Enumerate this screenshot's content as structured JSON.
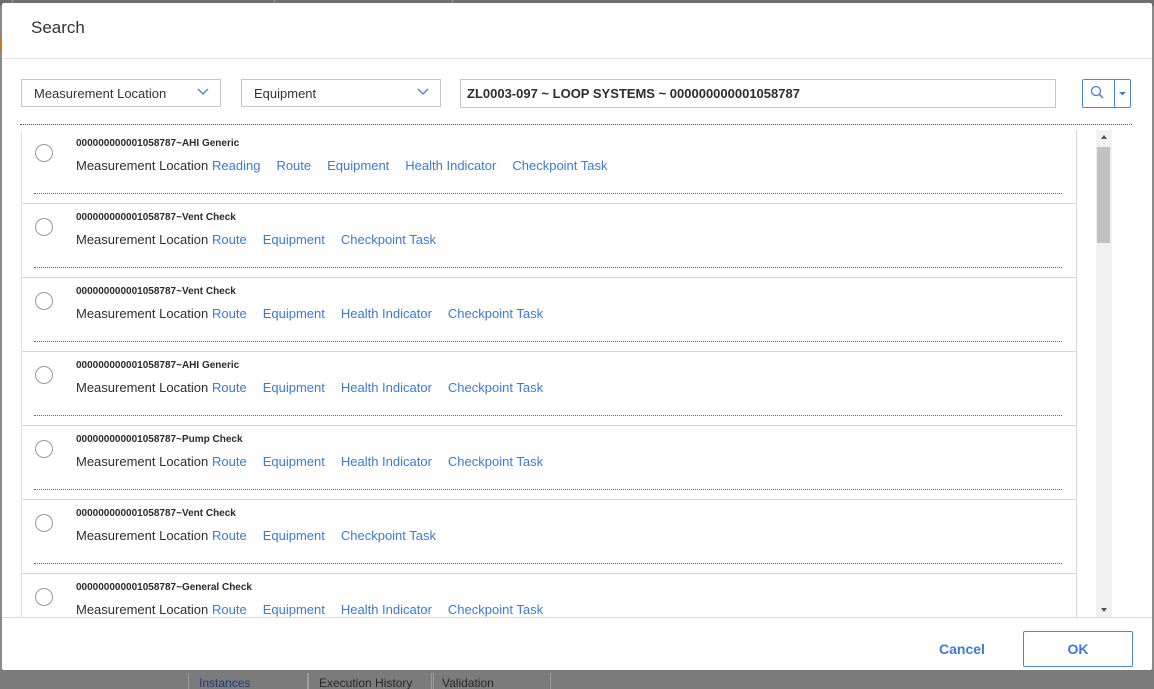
{
  "dialog": {
    "title": "Search"
  },
  "filters": {
    "family_select": "Measurement Location",
    "related_select": "Equipment",
    "search_value": "ZL0003-097 ~ LOOP SYSTEMS ~ 000000000001058787"
  },
  "results": [
    {
      "title": "000000000001058787~AHI Generic",
      "type": "Measurement Location",
      "links": [
        "Reading",
        "Route",
        "Equipment",
        "Health Indicator",
        "Checkpoint Task"
      ]
    },
    {
      "title": "000000000001058787~Vent Check",
      "type": "Measurement Location",
      "links": [
        "Route",
        "Equipment",
        "Checkpoint Task"
      ]
    },
    {
      "title": "000000000001058787~Vent Check",
      "type": "Measurement Location",
      "links": [
        "Route",
        "Equipment",
        "Health Indicator",
        "Checkpoint Task"
      ]
    },
    {
      "title": "000000000001058787~AHI Generic",
      "type": "Measurement Location",
      "links": [
        "Route",
        "Equipment",
        "Health Indicator",
        "Checkpoint Task"
      ]
    },
    {
      "title": "000000000001058787~Pump Check",
      "type": "Measurement Location",
      "links": [
        "Route",
        "Equipment",
        "Health Indicator",
        "Checkpoint Task"
      ]
    },
    {
      "title": "000000000001058787~Vent Check",
      "type": "Measurement Location",
      "links": [
        "Route",
        "Equipment",
        "Checkpoint Task"
      ]
    },
    {
      "title": "000000000001058787~General Check",
      "type": "Measurement Location",
      "links": [
        "Route",
        "Equipment",
        "Health Indicator",
        "Checkpoint Task"
      ]
    }
  ],
  "footer": {
    "cancel_label": "Cancel",
    "ok_label": "OK"
  },
  "background": {
    "tabs": [
      "Instances",
      "Execution History",
      "Validation"
    ]
  },
  "colors": {
    "accent": "#3a7bd5",
    "border_accent": "#4a88d6"
  },
  "icons": {
    "search": "search-icon",
    "dropdown": "chevron-down-icon",
    "caret": "caret-down-icon"
  }
}
